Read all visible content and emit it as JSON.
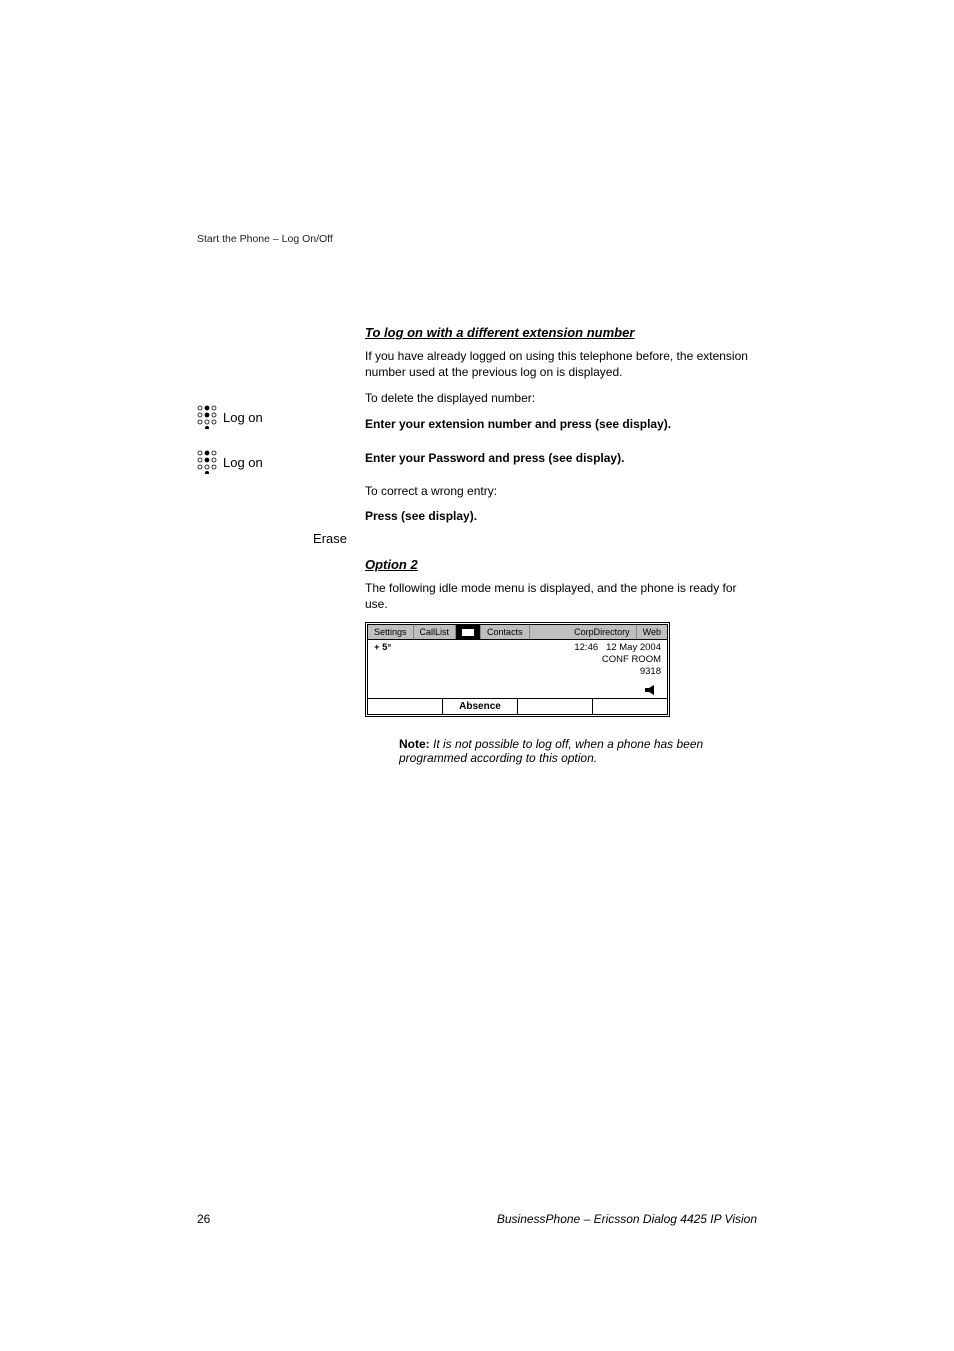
{
  "header": "Start the Phone – Log On/Off",
  "sections": {
    "diffExt": {
      "title": "To log on with a different extension number",
      "intro": "If you have already logged on using this telephone before, the extension number used at the previous log on is displayed.",
      "to_delete": "To delete the displayed number:",
      "log_on_label_1": "Log on",
      "instr_1": "Enter your extension number and press (see display).",
      "log_on_label_2": "Log on",
      "instr_2": "Enter your Password and press (see display).",
      "to_correct": "To correct a wrong entry:",
      "erase_label": "Erase",
      "erase_instr": "Press (see display)."
    },
    "option2": {
      "title": "Option 2",
      "intro": "The following idle mode menu is displayed, and the phone is ready for use.",
      "note_label": "Note:",
      "note_body": "It is not possible to log off, when a phone has been programmed according to this option."
    }
  },
  "phone_display": {
    "tabs": [
      "Settings",
      "CallList",
      "",
      "Contacts",
      "CorpDirectory",
      "Web"
    ],
    "active_tab_index": 2,
    "temp": "+ 5°",
    "time": "12:46",
    "date": "12 May 2004",
    "room": "CONF ROOM",
    "ext": "9318",
    "softkeys": [
      "",
      "Absence",
      "",
      ""
    ]
  },
  "footer": {
    "page": "26",
    "title": "BusinessPhone – Ericsson Dialog 4425 IP Vision"
  }
}
